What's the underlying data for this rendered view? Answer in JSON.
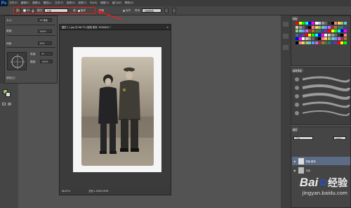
{
  "app": {
    "logo": "Ps"
  },
  "menu": [
    "文件(F)",
    "编辑(E)",
    "图像(I)",
    "图层(L)",
    "文字(Y)",
    "选择(S)",
    "滤镜(T)",
    "3D(D)",
    "视图(V)",
    "窗口(W)",
    "帮助(H)"
  ],
  "options": {
    "mode_label": "模式:",
    "mode_value": "正常",
    "size_value": "30",
    "sample_label": "源:",
    "sample_value": "取样",
    "pattern_label": "图案",
    "align_label": "对齐",
    "sample_all_label": "样本:",
    "sample_all_value": "当前图层"
  },
  "brush_panel": {
    "size_label": "大小:",
    "size_value": "19 像素",
    "hardness_label": "硬度:",
    "hardness_value": "100%",
    "spacing_label": "间距:",
    "spacing_value": "25%",
    "angle_label": "角度:",
    "angle_value": "0°",
    "roundness_label": "圆度:",
    "roundness_value": "100%",
    "pressure_label": "钢笔压力"
  },
  "document": {
    "tab_title": "图层 1 (.jpg @ 66.7% (图层 副本, RGB/8#) *",
    "zoom": "66.67%",
    "doc_info": "文档:1.32M/2.85M"
  },
  "right_panels": {
    "swatches_tab": "色板",
    "brushes_tab": "画笔预设",
    "layers_tab": "图层",
    "blend_mode": "正常",
    "opacity": "100%",
    "layer_top": "背景 副本",
    "layer_bottom": "背景"
  },
  "colors": {
    "accent_red": "#e02020",
    "foreground": "#9ac06a",
    "background": "#e0e0e0"
  },
  "watermark": {
    "brand": "Bai",
    "brand2": "经验",
    "url": "jingyan.baidu.com"
  }
}
